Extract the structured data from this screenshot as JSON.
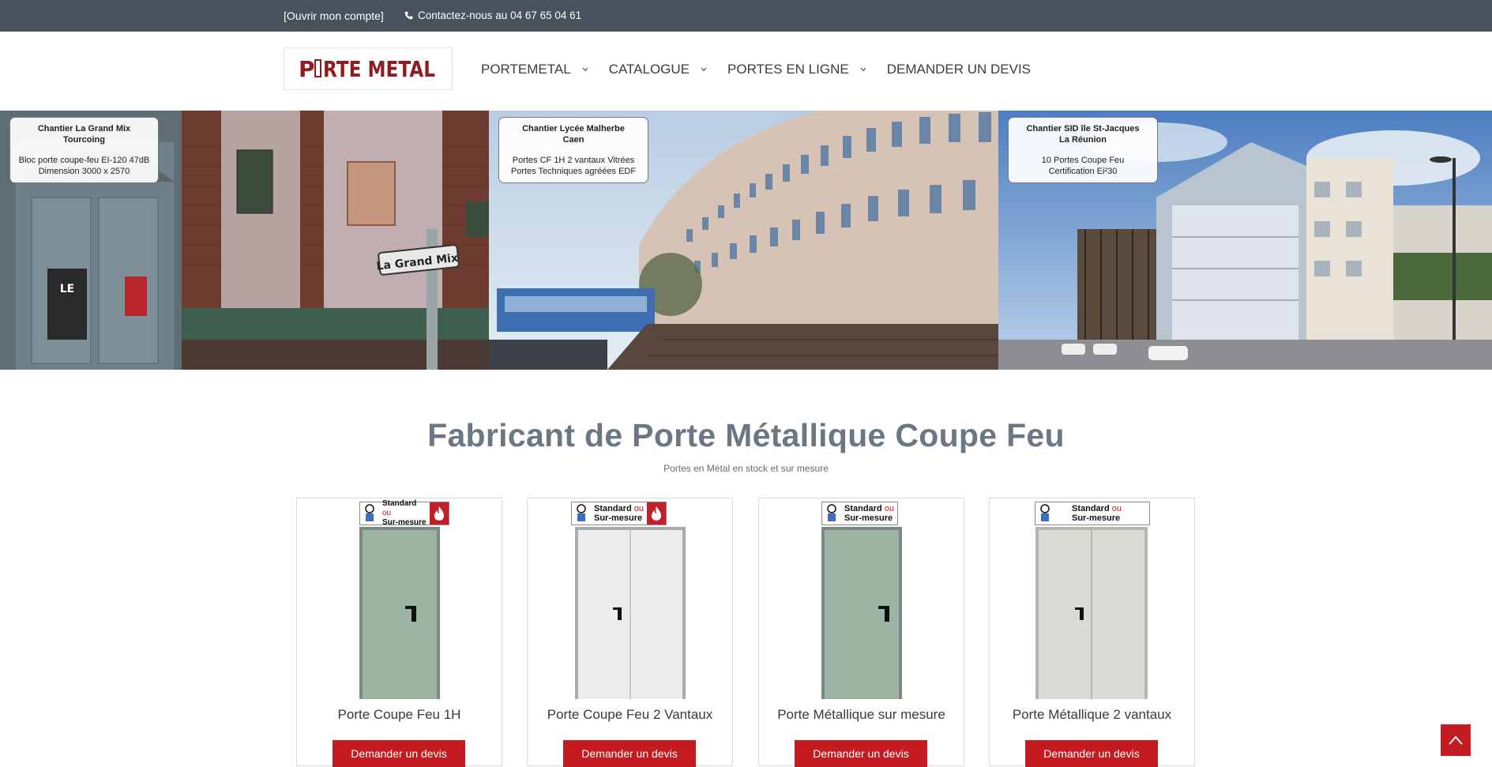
{
  "topbar": {
    "account_label": "[Ouvrir mon compte]",
    "phone_label": "Contactez-nous au 04 67 65 04 61"
  },
  "logo": {
    "text_a": "P",
    "text_b": "RTE METAL"
  },
  "nav": {
    "items": [
      {
        "label": "PORTEMETAL"
      },
      {
        "label": "CATALOGUE"
      },
      {
        "label": "PORTES EN LIGNE"
      },
      {
        "label": "DEMANDER UN DEVIS"
      }
    ]
  },
  "hero": {
    "panels": [
      {
        "title_line1": "Chantier La Grand Mix",
        "title_line2": "Tourcoing",
        "body_line1": "Bloc porte coupe-feu EI-120 47dB",
        "body_line2": "Dimension 3000 x 2570",
        "sign_text": "La Grand Mix",
        "poster_text": "LE GRAND MIX"
      },
      {
        "title_line1": "Chantier Lycée Malherbe",
        "title_line2": "Caen",
        "body_line1": "Portes CF 1H 2 vantaux Vitrées",
        "body_line2": "Portes Techniques agréées EDF"
      },
      {
        "title_line1": "Chantier SID île St-Jacques",
        "title_line2": "La Réunion",
        "body_line1": "10 Portes Coupe Feu",
        "body_line2": "Certification Ei²30"
      }
    ]
  },
  "main": {
    "heading": "Fabricant de Porte Métallique Coupe Feu",
    "subheading": "Portes en Métal en stock et sur mesure"
  },
  "products": [
    {
      "name": "Porte Coupe Feu 1H",
      "button": "Demander un devis",
      "badge_line1": "Standard",
      "badge_ou": "ou",
      "badge_line2": "Sur-mesure",
      "door_color": "#9db4a4",
      "double": false,
      "fire": true
    },
    {
      "name": "Porte Coupe Feu 2 Vantaux",
      "button": "Demander un devis",
      "badge_line1": "Standard",
      "badge_ou": "ou",
      "badge_line2": "Sur-mesure",
      "door_color": "#ececec",
      "double": true,
      "fire": true
    },
    {
      "name": "Porte Métallique sur mesure",
      "button": "Demander un devis",
      "badge_line1": "Standard",
      "badge_ou": "ou",
      "badge_line2": "Sur-mesure",
      "door_color": "#9db4a4",
      "double": false,
      "fire": false
    },
    {
      "name": "Porte Métallique 2 vantaux",
      "button": "Demander un devis",
      "badge_line1": "Standard",
      "badge_ou": "ou",
      "badge_line2": "Sur-mesure",
      "door_color": "#dadbd4",
      "double": true,
      "fire": false
    }
  ],
  "colors": {
    "topbar": "#47525c",
    "accent_red": "#c41b20",
    "heading": "#6c7784"
  }
}
